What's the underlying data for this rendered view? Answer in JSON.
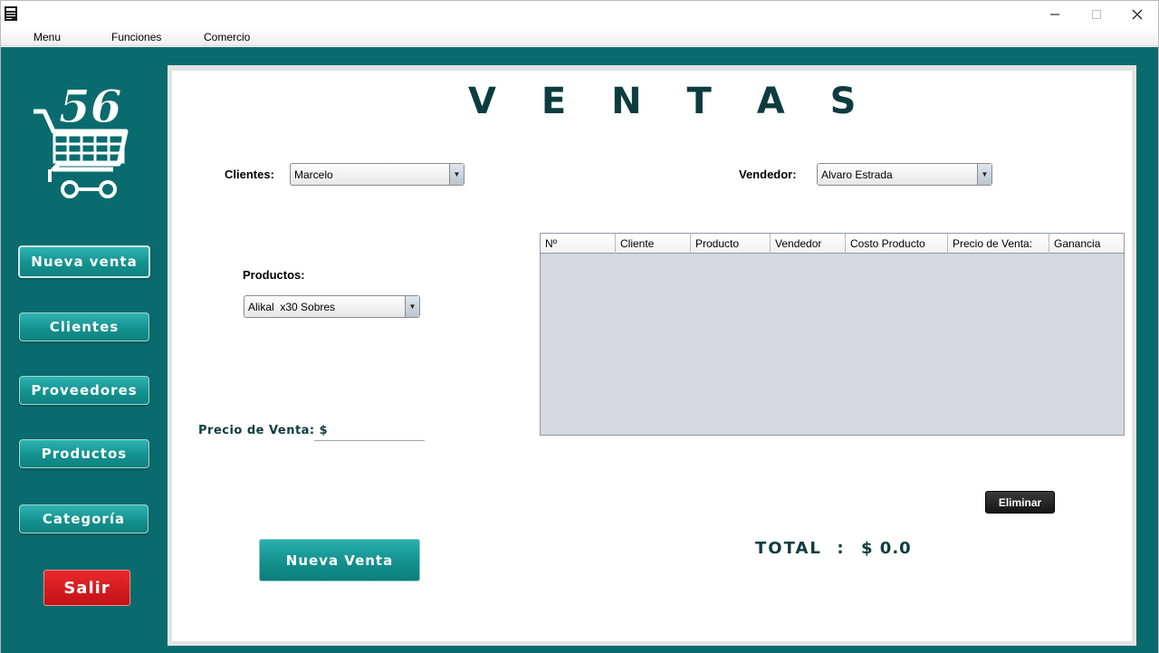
{
  "window": {
    "title": ""
  },
  "menubar": {
    "items": [
      "Menu",
      "Funciones",
      "Comercio"
    ]
  },
  "sidebar": {
    "logo_number": "56",
    "buttons": [
      "Nueva venta",
      "Clientes",
      "Proveedores",
      "Productos",
      "Categoría"
    ],
    "exit_label": "Salir"
  },
  "main": {
    "title": "V E N T A S",
    "clientes_label": "Clientes:",
    "clientes_value": "Marcelo",
    "vendedor_label": "Vendedor:",
    "vendedor_value": "Alvaro Estrada",
    "productos_label": "Productos:",
    "productos_value": "Alikal  x30 Sobres",
    "precio_label": "Precio de Venta: $",
    "precio_value": "",
    "nueva_venta_label": "Nueva Venta",
    "eliminar_label": "Eliminar",
    "total_label": "TOTAL  :",
    "total_value": "$ 0.0"
  },
  "table": {
    "columns": [
      "Nº",
      "Cliente",
      "Producto",
      "Vendedor",
      "Costo Producto",
      "Precio de Venta:",
      "Ganancia"
    ],
    "rows": []
  },
  "colors": {
    "frame_teal": "#0a6b6e",
    "button_teal": "#13928f",
    "exit_red": "#d01a1d",
    "title_dark": "#0d3c3f"
  }
}
